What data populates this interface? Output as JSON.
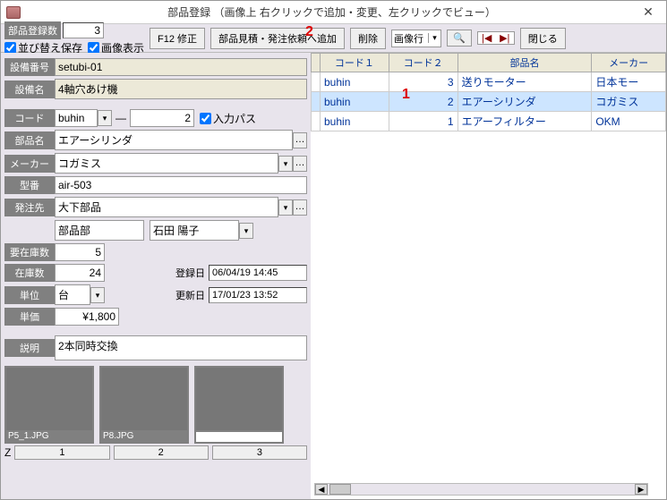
{
  "window": {
    "title": "部品登録 （画像上 右クリックで追加・変更、左クリックでビュー）"
  },
  "annotations": {
    "one": "1",
    "two": "2"
  },
  "toolbar": {
    "count_label": "部品登録数",
    "count_value": "3",
    "sort_save": "並び替え保存",
    "image_disp": "画像表示",
    "f12": "F12 修正",
    "estimate": "部品見積・発注依頼へ追加",
    "delete": "削除",
    "image_combo": "画像行",
    "close": "閉じる"
  },
  "labels": {
    "setubi_no": "設備番号",
    "setubi_name": "設備名",
    "code": "コード",
    "input_pass": "入力パス",
    "buhin_name": "部品名",
    "maker": "メーカー",
    "kataban": "型番",
    "hacchu": "発注先",
    "yozai": "要在庫数",
    "zaiko": "在庫数",
    "touroku": "登録日",
    "koushin": "更新日",
    "tani": "単位",
    "tanka": "単価",
    "setsumei": "説明",
    "z": "Z"
  },
  "form": {
    "setubi_no": "setubi-01",
    "setubi_name": "4軸穴あけ機",
    "code": "buhin",
    "code_seq": "2",
    "buhin_name": "エアーシリンダ",
    "maker": "コガミス",
    "kataban": "air-503",
    "hacchu": "大下部品",
    "dept": "部品部",
    "person": "石田 陽子",
    "yozai": "5",
    "zaiko": "24",
    "touroku": "06/04/19 14:45",
    "koushin": "17/01/23 13:52",
    "tani": "台",
    "tanka": "¥1,800",
    "setsumei": "2本同時交換"
  },
  "images": [
    {
      "caption": "P5_1.JPG",
      "z": "1"
    },
    {
      "caption": "P8.JPG",
      "z": "2"
    },
    {
      "caption": "",
      "z": "3"
    }
  ],
  "grid": {
    "headers": {
      "code1": "コード１",
      "code2": "コード２",
      "buhin": "部品名",
      "maker": "メーカー"
    },
    "rows": [
      {
        "code1": "buhin",
        "code2": "3",
        "buhin": "送りモーター",
        "maker": "日本モー",
        "sel": false
      },
      {
        "code1": "buhin",
        "code2": "2",
        "buhin": "エアーシリンダ",
        "maker": "コガミス",
        "sel": true
      },
      {
        "code1": "buhin",
        "code2": "1",
        "buhin": "エアーフィルター",
        "maker": "OKM",
        "sel": false
      }
    ]
  }
}
